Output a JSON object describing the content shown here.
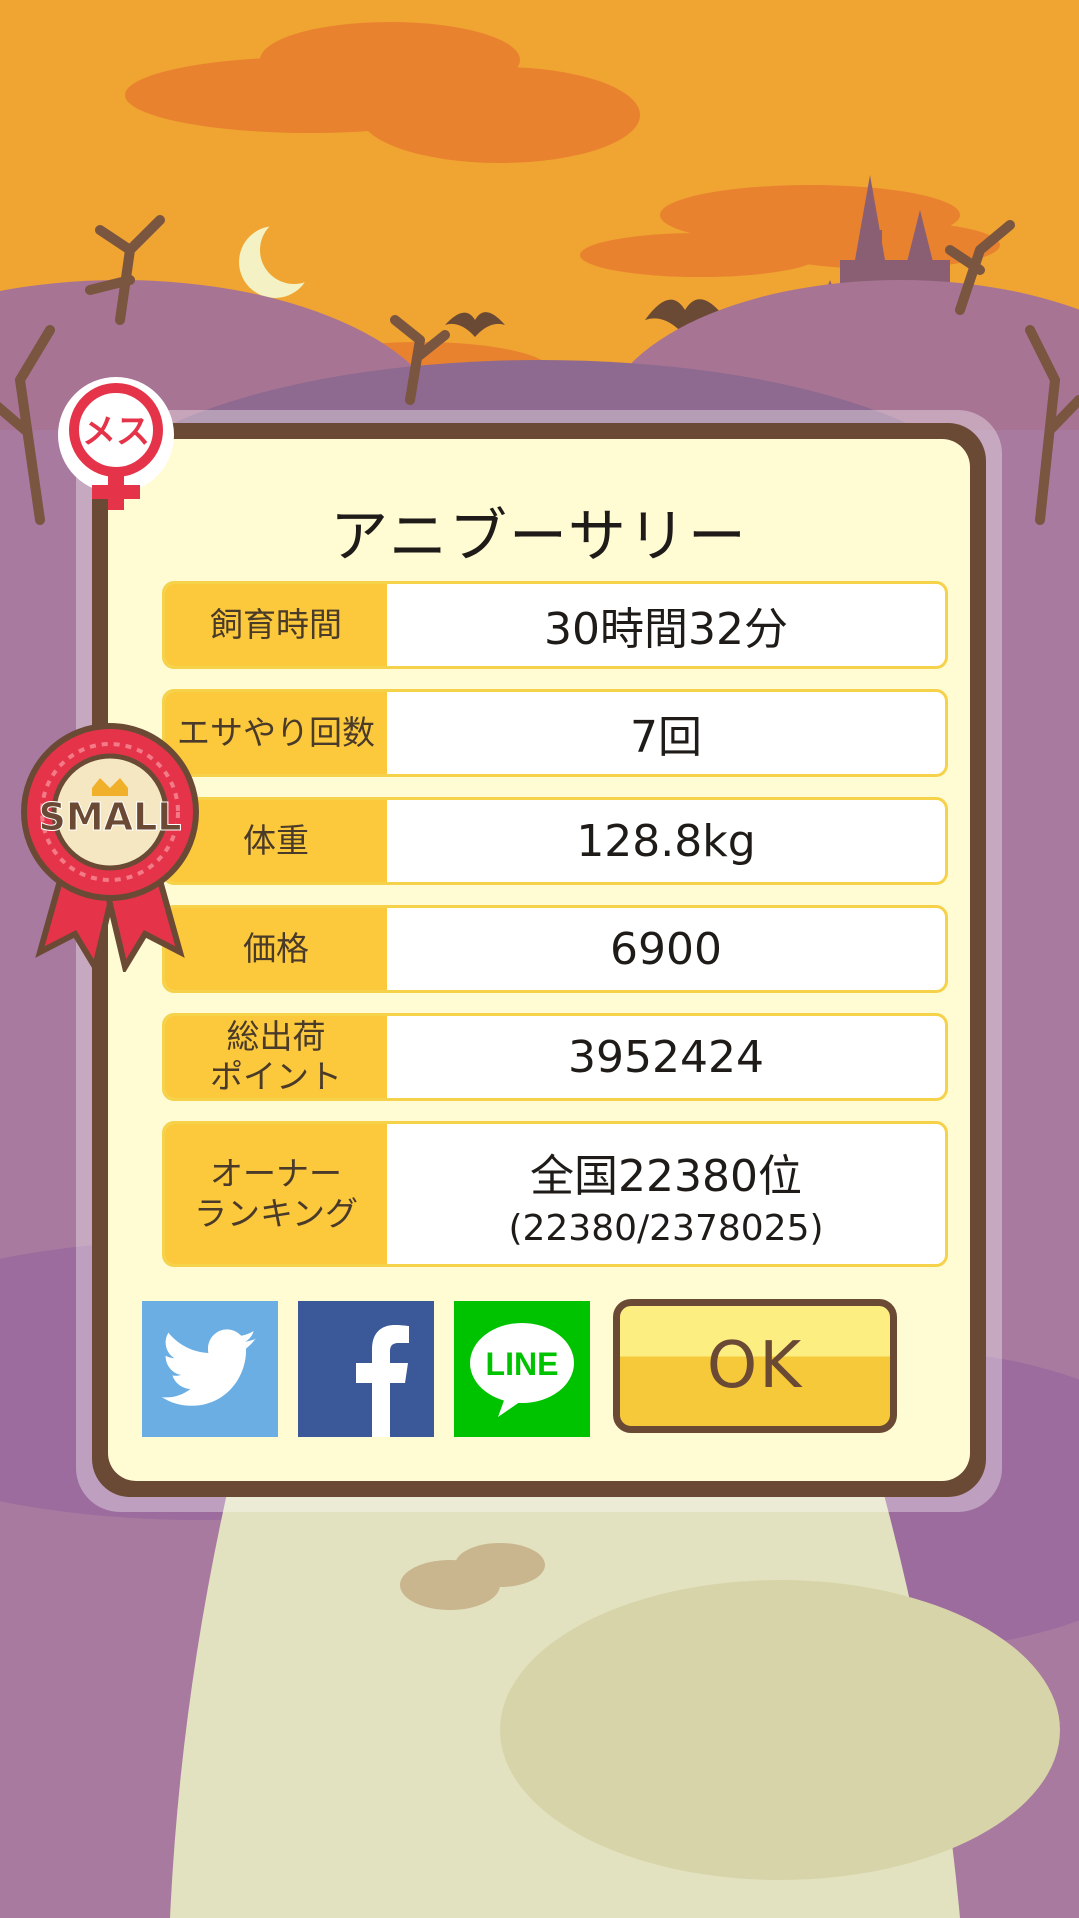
{
  "dialog": {
    "title": "アニブーサリー",
    "rows": [
      {
        "label": "飼育時間",
        "value": "30時間32分"
      },
      {
        "label": "エサやり回数",
        "value": "7回"
      },
      {
        "label": "体重",
        "value": "128.8kg"
      },
      {
        "label": "価格",
        "value": "6900"
      },
      {
        "label": "総出荷\nポイント",
        "value": "3952424"
      },
      {
        "label": "オーナー\nランキング",
        "value": "全国22380位",
        "value_sub": "(22380/2378025)"
      }
    ],
    "ok_label": "OK"
  },
  "social": {
    "twitter_icon": "twitter-icon",
    "facebook_icon": "facebook-icon",
    "line_label": "LINE"
  },
  "badges": {
    "gender": "メス",
    "size": "SMALL"
  },
  "colors": {
    "sky": "#f0a431",
    "dialog_border": "#6b4a35",
    "dialog_bg": "#fffbd3",
    "label_bg": "#fbc93b",
    "twitter": "#6aaee3",
    "facebook": "#3b5998",
    "line": "#00c300",
    "ok_top": "#fdee82",
    "ok_bottom": "#f5c93a"
  }
}
